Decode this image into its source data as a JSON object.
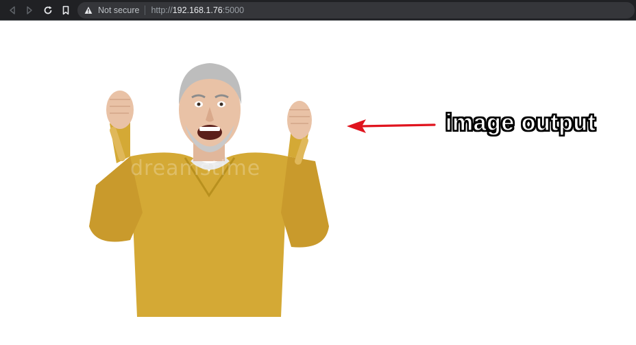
{
  "browser": {
    "security_label": "Not secure",
    "url_scheme": "http://",
    "url_host": "192.168.1.76",
    "url_port": ":5000",
    "icons": [
      "back-icon",
      "forward-icon",
      "reload-icon",
      "bookmark-icon",
      "warning-icon"
    ]
  },
  "page": {
    "annotation": "image output",
    "image_watermark": "dreamstime",
    "arrow_color": "#e0141e",
    "sweater_color": "#d4a935"
  }
}
